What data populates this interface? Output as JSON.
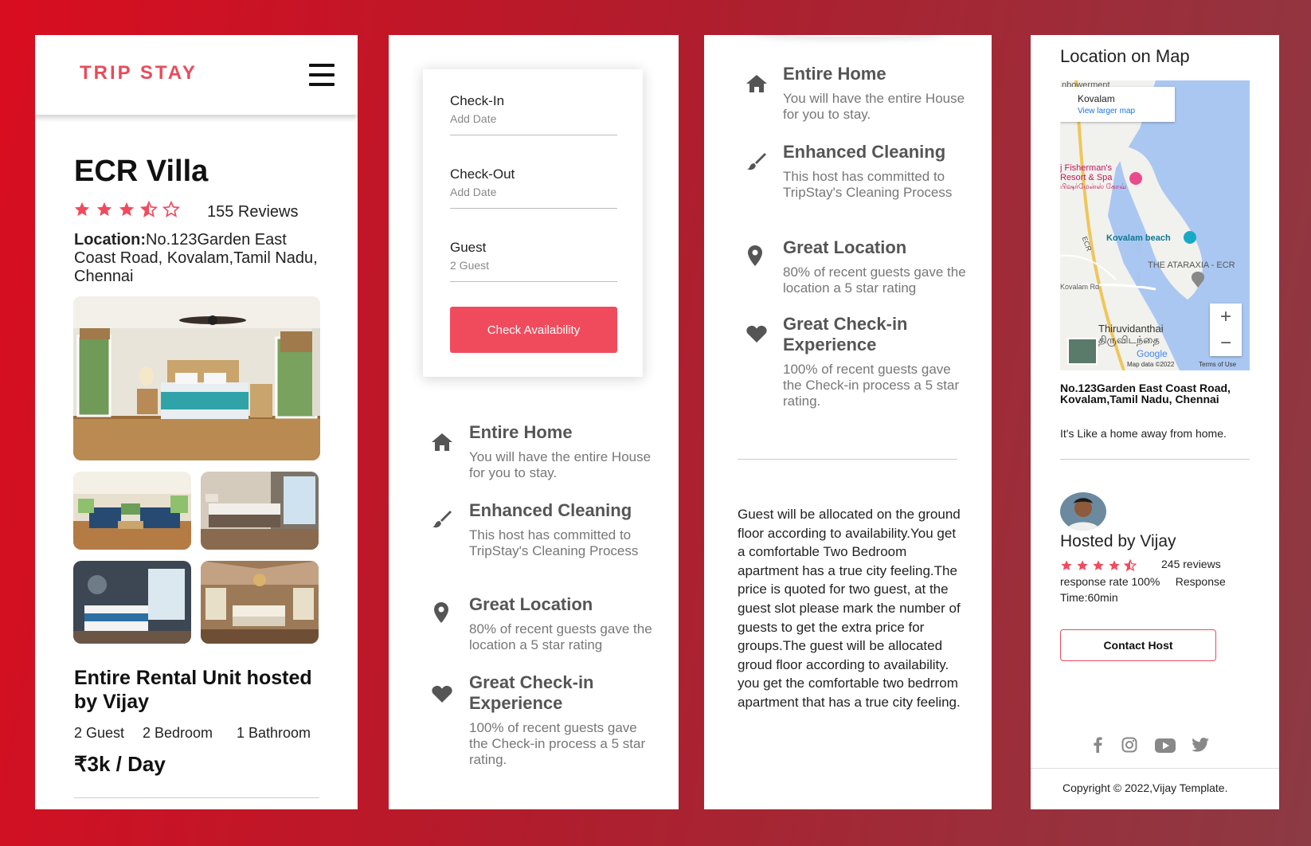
{
  "brand": {
    "logo": "TRIP STAY"
  },
  "property": {
    "title": "ECR Villa",
    "rating": 3.5,
    "reviews": "155 Reviews",
    "location_label": "Location:",
    "location": "No.123Garden East Coast Road, Kovalam,Tamil Nadu, Chennai",
    "subtitle": "Entire Rental Unit hosted by Vijay",
    "guests": "2 Guest",
    "bedrooms": "2 Bedroom",
    "bathrooms": "1 Bathroom",
    "price": "₹3k / Day"
  },
  "booking": {
    "checkin_label": "Check-In",
    "checkin_value": "Add Date",
    "checkout_label": "Check-Out",
    "checkout_value": "Add Date",
    "guest_label": "Guest",
    "guest_value": "2 Guest",
    "button": "Check Availability"
  },
  "features": [
    {
      "icon": "home-icon",
      "title": "Entire Home",
      "desc": "You will have the entire House for you to stay."
    },
    {
      "icon": "brush-icon",
      "title": "Enhanced Cleaning",
      "desc": "This host has committed to TripStay's Cleaning Process"
    },
    {
      "icon": "location-pin-icon",
      "title": "Great Location",
      "desc": "80% of recent guests gave the location a 5 star rating"
    },
    {
      "icon": "heart-icon",
      "title": "Great Check-in Experience",
      "desc": "100% of recent guests gave the Check-in process a 5 star rating."
    }
  ],
  "description": "Guest will be allocated on the ground floor according to availability.You get a comfortable Two Bedroom apartment has a true city feeling.The price is quoted for two guest, at the guest slot please mark the number of guests to get the extra price for groups.The guest will be allocated groud floor according to availability. you get the comfortable two bedrrom apartment that has a true city feeling.",
  "map": {
    "title": "Location on Map",
    "card_title": "Kovalam",
    "card_link": "View larger map",
    "labels": {
      "top": "nbowerment",
      "resort": "j Fisherman's Resort & Spa",
      "resort_tamil": "பிஷர்மேன்ஸ் கோவ்",
      "beach": "Kovalam beach",
      "ataraxia": "THE ATARAXIA - ECR",
      "ecr": "ECR",
      "road": "Kovalam Rd",
      "town": "Thiruvidanthai",
      "town_tamil": "திருவிடந்தை",
      "google": "Google",
      "mapdata": "Map data ©2022",
      "terms": "Terms of Use"
    },
    "zoom_in": "+",
    "zoom_out": "−"
  },
  "address": "No.123Garden East Coast Road, Kovalam,Tamil Nadu, Chennai",
  "tagline": "It's Like a home away from home.",
  "host": {
    "hosted_by": "Hosted by Vijay",
    "rating": 4.5,
    "reviews": "245 reviews",
    "meta": "response rate 100%     Response Time:60min",
    "contact_button": "Contact Host"
  },
  "socials": [
    "facebook-icon",
    "instagram-icon",
    "youtube-icon",
    "twitter-icon"
  ],
  "footer": {
    "copyright": "Copyright © 2022,Vijay Template."
  },
  "colors": {
    "accent": "#f04b5d",
    "logo": "#e94b5b",
    "icon_gray": "#555555"
  }
}
